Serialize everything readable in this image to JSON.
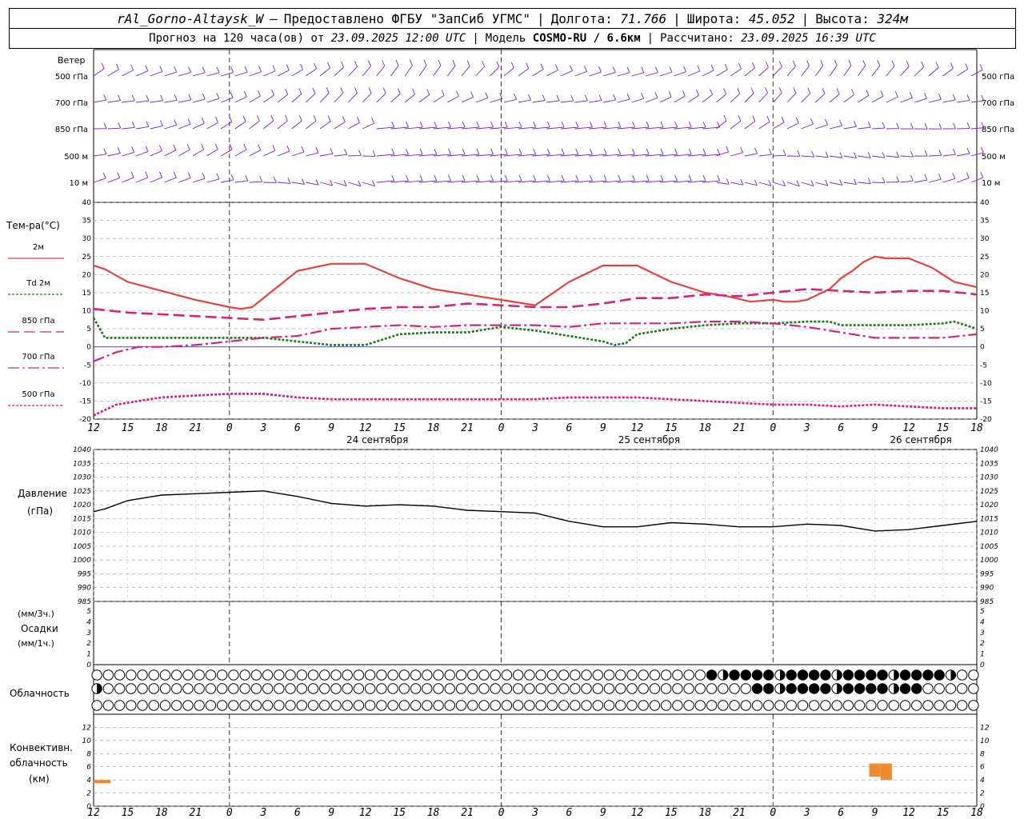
{
  "header": {
    "station": "rAl_Gorno-Altaysk_W",
    "provider_sep": "–",
    "provider": "Предоставлено ФГБУ \"ЗапСиб УГМС\"",
    "lon_label": "Долгота:",
    "lon": "71.766",
    "lat_label": "Широта:",
    "lat": "45.052",
    "alt_label": "Высота:",
    "alt": "324м",
    "forecast_prefix": "Прогноз на 120 часа(ов) от",
    "forecast_time": "23.09.2025 12:00 UTC",
    "model_prefix": "Модель",
    "model": "COSMO-RU / 6.6км",
    "calc_prefix": "Рассчитано:",
    "calc_time": "23.09.2025 16:39 UTC"
  },
  "time_axis": {
    "hour_ticks": [
      "12",
      "15",
      "18",
      "21",
      "0",
      "3",
      "6",
      "9",
      "12",
      "15",
      "18",
      "21",
      "0",
      "3",
      "6",
      "9",
      "12",
      "15",
      "18",
      "21",
      "0",
      "3",
      "6",
      "9",
      "12",
      "15",
      "18"
    ],
    "day_labels": [
      {
        "label": "24 сентября",
        "at_hour": 24
      },
      {
        "label": "25 сентября",
        "at_hour": 48
      },
      {
        "label": "26 сентября",
        "at_hour": 72
      }
    ],
    "midnight_hours": [
      12,
      36,
      60
    ],
    "range_hours": [
      0,
      78
    ]
  },
  "colors": {
    "t2m": "#e8413c",
    "td2m": "#1a7a1a",
    "t850": "#d6247a",
    "t700": "#d6247a",
    "t500": "#e0157a",
    "wind": "#7a1fd6",
    "zero_line": "#3a3ad0",
    "conv_cloud": "#f08a30"
  },
  "chart_data": [
    {
      "type": "wind_barbs",
      "title": "Ветер",
      "levels": [
        "500 гПа",
        "700 гПа",
        "850 гПа",
        "500 м",
        "10   м"
      ]
    },
    {
      "type": "line",
      "ylabel": "Тем-ра(°C)",
      "ylim": [
        -20,
        40
      ],
      "yticks": [
        -20,
        -15,
        -10,
        -5,
        0,
        5,
        10,
        15,
        20,
        25,
        30,
        35,
        40
      ],
      "series": [
        {
          "name": "2м",
          "style": "solid",
          "x": [
            0,
            1,
            3,
            6,
            9,
            12,
            13,
            14,
            16,
            18,
            21,
            24,
            27,
            30,
            33,
            36,
            39,
            42,
            45,
            48,
            51,
            54,
            56,
            58,
            60,
            61,
            62,
            63,
            65,
            66,
            67,
            68,
            69,
            70,
            72,
            74,
            75,
            76,
            78
          ],
          "y": [
            22.5,
            21.5,
            18,
            15.5,
            13,
            11,
            10.5,
            11,
            16,
            21,
            23,
            23,
            19,
            16,
            14.5,
            13,
            11.5,
            18,
            22.5,
            22.5,
            18,
            15,
            14,
            12.5,
            13,
            12.5,
            12.5,
            13,
            16,
            19,
            21,
            23.5,
            25,
            24.5,
            24.5,
            22,
            20,
            18,
            16.5
          ]
        },
        {
          "name": "Td 2м",
          "style": "dotted",
          "x": [
            0,
            1,
            3,
            6,
            9,
            12,
            15,
            18,
            21,
            24,
            27,
            30,
            33,
            36,
            39,
            42,
            45,
            46,
            47,
            48,
            51,
            54,
            57,
            60,
            63,
            65,
            66,
            69,
            72,
            75,
            76,
            78
          ],
          "y": [
            8,
            2.5,
            2.5,
            2.5,
            2.5,
            2.5,
            2.5,
            1.5,
            0.5,
            0.5,
            3.5,
            4,
            4,
            5.5,
            4.5,
            3,
            1.5,
            0.5,
            1,
            3.5,
            5,
            6,
            6.5,
            6.5,
            7,
            7,
            6,
            6,
            6,
            6.5,
            7,
            5
          ]
        },
        {
          "name": "850 гПа",
          "style": "dashed",
          "x": [
            0,
            3,
            6,
            9,
            12,
            15,
            18,
            21,
            24,
            27,
            30,
            33,
            36,
            39,
            42,
            45,
            48,
            51,
            54,
            57,
            60,
            63,
            66,
            69,
            72,
            75,
            78
          ],
          "y": [
            10.5,
            9.5,
            9,
            8.5,
            8,
            7.5,
            8.5,
            9.5,
            10.5,
            11,
            11,
            12,
            11.5,
            11,
            11,
            12,
            13.5,
            13.5,
            14.5,
            14,
            15,
            16,
            15.5,
            15,
            15.5,
            15.5,
            14.5
          ]
        },
        {
          "name": "700 гПа",
          "style": "dashdot",
          "x": [
            0,
            2,
            4,
            6,
            9,
            12,
            15,
            18,
            21,
            24,
            27,
            30,
            33,
            36,
            39,
            42,
            45,
            48,
            51,
            54,
            57,
            60,
            63,
            66,
            69,
            72,
            75,
            78
          ],
          "y": [
            -4,
            -1.5,
            0,
            0,
            0.5,
            1.5,
            2.5,
            3,
            5,
            5.5,
            6,
            5.5,
            6,
            6,
            6,
            5.5,
            6.5,
            6.5,
            6.5,
            7,
            7,
            6.5,
            5.5,
            4,
            2.5,
            2.5,
            2.5,
            3.5
          ]
        },
        {
          "name": "500 гПа",
          "style": "dotted",
          "x": [
            0,
            2,
            4,
            6,
            9,
            12,
            15,
            18,
            21,
            24,
            27,
            30,
            33,
            36,
            39,
            42,
            45,
            48,
            51,
            54,
            57,
            60,
            63,
            66,
            69,
            72,
            75,
            78
          ],
          "y": [
            -19,
            -16,
            -15,
            -14,
            -13.5,
            -13,
            -13,
            -14,
            -14.5,
            -14.5,
            -14.5,
            -14.5,
            -14.5,
            -14.5,
            -14.5,
            -14,
            -14,
            -14,
            -14.5,
            -15,
            -15.5,
            -16,
            -16,
            -16.5,
            -16,
            -16.5,
            -17,
            -17
          ]
        }
      ]
    },
    {
      "type": "line",
      "ylabel": "Давление",
      "yunit": "(гПа)",
      "ylim": [
        985,
        1040
      ],
      "yticks": [
        985,
        990,
        995,
        1000,
        1005,
        1010,
        1015,
        1020,
        1025,
        1030,
        1035,
        1040
      ],
      "series": [
        {
          "x": [
            0,
            1,
            3,
            6,
            9,
            12,
            15,
            18,
            21,
            24,
            27,
            30,
            33,
            36,
            39,
            42,
            45,
            48,
            51,
            54,
            57,
            60,
            63,
            66,
            69,
            72,
            75,
            78
          ],
          "y": [
            1017.5,
            1018.5,
            1021.5,
            1023.5,
            1024,
            1024.5,
            1025,
            1023,
            1020.5,
            1019.5,
            1020,
            1019.5,
            1018,
            1017.5,
            1017,
            1014,
            1012,
            1012,
            1013.5,
            1013,
            1012,
            1012,
            1013,
            1012.5,
            1010.5,
            1011,
            1012.5,
            1014
          ]
        }
      ]
    },
    {
      "type": "bar",
      "ylabel_top": "(мм/3ч.)",
      "ylabel": "Осадки",
      "ylabel_bottom": "(мм/1ч.)",
      "ylim": [
        0,
        5
      ],
      "yticks": [
        0,
        1,
        2,
        3,
        4,
        5
      ],
      "values": []
    },
    {
      "type": "cloud_cover",
      "ylabel": "Облачность",
      "rows": 3,
      "steps_per_row": 78,
      "high": [
        {
          "from": 54,
          "to": 75,
          "fill": "mixed"
        }
      ],
      "middle": [
        {
          "from": 58,
          "to": 72,
          "fill": "mixed"
        }
      ],
      "low_first": "half"
    },
    {
      "type": "bar",
      "ylabel": "Конвективн.",
      "ylabel2": "облачность",
      "yunit": "(км)",
      "ylim": [
        0,
        14
      ],
      "yticks": [
        0,
        2,
        4,
        6,
        8,
        10,
        12
      ],
      "bars": [
        {
          "x0": 0,
          "x1": 1.5,
          "y0": 3.5,
          "y1": 4
        },
        {
          "x0": 68.5,
          "x1": 69.5,
          "y0": 4.5,
          "y1": 6.5
        },
        {
          "x0": 69.5,
          "x1": 70.5,
          "y0": 4,
          "y1": 6.5
        }
      ]
    }
  ]
}
